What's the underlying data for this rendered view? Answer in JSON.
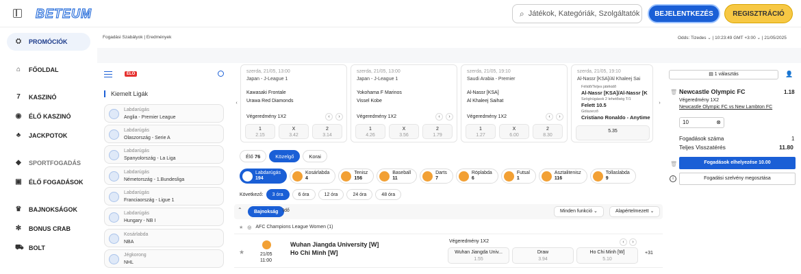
{
  "header": {
    "logo": "BETEUM",
    "search_placeholder": "Játékok, Kategóriák, Szolgáltatók",
    "login_label": "BEJELENTKEZÉS",
    "register_label": "REGISZTRÁCIÓ"
  },
  "sidebar": {
    "items": [
      {
        "label": "PROMÓCIÓK",
        "icon": "gift-icon"
      },
      {
        "label": "FŐOLDAL",
        "icon": "home-icon"
      },
      {
        "label": "KASZINÓ",
        "icon": "seven-icon"
      },
      {
        "label": "ÉLŐ KASZINÓ",
        "icon": "chip-icon"
      },
      {
        "label": "JACKPOTOK",
        "icon": "coins-icon"
      },
      {
        "label": "SPORTFOGADÁS",
        "icon": "diamond-icon"
      },
      {
        "label": "ÉLŐ FOGADÁSOK",
        "icon": "live-icon"
      },
      {
        "label": "BAJNOKSÁGOK",
        "icon": "trophy-icon"
      },
      {
        "label": "BONUS CRAB",
        "icon": "crab-icon"
      },
      {
        "label": "BOLT",
        "icon": "cart-icon"
      }
    ]
  },
  "subheader": {
    "left": "Fogadási Szabályok  |  Eredmények",
    "right": "Odds: Tizedes ⌄  |  10:23:49 GMT +3:00 ⌄  |  21/05/2025"
  },
  "left_panel": {
    "live_badge": "ÉLŐ",
    "featured_title": "Kiemelt Ligák",
    "leagues": [
      {
        "sport": "Labdarúgás",
        "name": "Anglia - Premier League"
      },
      {
        "sport": "Labdarúgás",
        "name": "Olaszország - Serie A"
      },
      {
        "sport": "Labdarúgás",
        "name": "Spanyolország - La Liga"
      },
      {
        "sport": "Labdarúgás",
        "name": "Németország - 1.Bundesliga"
      },
      {
        "sport": "Labdarúgás",
        "name": "Franciaország - Ligue 1"
      },
      {
        "sport": "Labdarúgás",
        "name": "Hungary - NB I"
      },
      {
        "sport": "Kosárlabda",
        "name": "NBA"
      },
      {
        "sport": "Jégkorong",
        "name": "NHL"
      }
    ]
  },
  "events": [
    {
      "date": "szerda, 21/05, 13:00",
      "league": "Japan - J-League 1",
      "team1": "Kawasaki Frontale",
      "team2": "Urawa Red Diamonds",
      "market": "Végeredmény 1X2",
      "odds": [
        {
          "l": "1",
          "v": "2.15"
        },
        {
          "l": "X",
          "v": "3.42"
        },
        {
          "l": "2",
          "v": "3.14"
        }
      ]
    },
    {
      "date": "szerda, 21/05, 13:00",
      "league": "Japan - J-League 1",
      "team1": "Yokohama F Marinos",
      "team2": "Vissel Kobe",
      "market": "Végeredmény 1X2",
      "odds": [
        {
          "l": "1",
          "v": "4.26"
        },
        {
          "l": "X",
          "v": "3.56"
        },
        {
          "l": "2",
          "v": "1.79"
        }
      ]
    },
    {
      "date": "szerda, 21/05, 19:10",
      "league": "Saudi Arabia - Premier",
      "team1": "Al-Nassr [KSA]",
      "team2": "Al Khaleej Saihat",
      "market": "Végeredmény 1X2",
      "odds": [
        {
          "l": "1",
          "v": "1.27"
        },
        {
          "l": "X",
          "v": "6.00"
        },
        {
          "l": "2",
          "v": "8.30"
        }
      ]
    }
  ],
  "event4": {
    "date": "szerda, 21/05, 19:10",
    "league": "Al-Nassr [KSA]/Al Khaleej Sai",
    "lines": [
      "Félidő/Teljes játékidő",
      "Al-Nassr [KSA]/Al-Nassr [K",
      "Szöglrúgások 2 lehetőség T/1",
      "Felett 10.5",
      "Gólszerző",
      "Cristiano Ronaldo - Anytime"
    ],
    "odd": "5.35"
  },
  "tabs": [
    {
      "label": "Élő",
      "count": "76"
    },
    {
      "label": "Közelgő",
      "count": ""
    },
    {
      "label": "Korai",
      "count": ""
    }
  ],
  "sports": [
    {
      "label": "Labdarúgás",
      "count": "194"
    },
    {
      "label": "Kosárlabda",
      "count": "4"
    },
    {
      "label": "Tenisz",
      "count": "156"
    },
    {
      "label": "Baseball",
      "count": "11"
    },
    {
      "label": "Darts",
      "count": "7"
    },
    {
      "label": "Röplabda",
      "count": "6"
    },
    {
      "label": "Futsal",
      "count": "1"
    },
    {
      "label": "Asztalitenisz",
      "count": "116"
    },
    {
      "label": "Tollaslabda",
      "count": "9"
    }
  ],
  "next": {
    "label": "Következő:",
    "options": [
      "3 óra",
      "6 óra",
      "12 óra",
      "24 óra",
      "48 óra"
    ]
  },
  "filters": {
    "group1": "Bajnokság",
    "group2": "Idő",
    "sel1": "Minden funkció ⌄",
    "sel2": "Alapértelmezett ⌄"
  },
  "competition": "AFC Champions League Women (1)",
  "match": {
    "team1": "Wuhan Jiangda University [W]",
    "team2": "Ho Chi Minh [W]",
    "date": "21/05",
    "time": "11:00",
    "market": "Végeredmény 1X2",
    "odds": [
      {
        "l": "Wuhan Jiangda Univ...",
        "v": "1.55"
      },
      {
        "l": "Draw",
        "v": "3.94"
      },
      {
        "l": "Ho Chi Minh [W]",
        "v": "5.10"
      }
    ],
    "more": "+31"
  },
  "slip": {
    "selected": "1 választás",
    "team": "Newcastle Olympic FC",
    "odd": "1.18",
    "market": "Végeredmény 1X2",
    "match_link": "Newcastle Olympic FC vs New Lambton FC",
    "stake": "10",
    "bets_label": "Fogadások száma",
    "bets_value": "1",
    "return_label": "Teljes Visszatérés",
    "return_value": "11.80",
    "place_label": "Fogadások elhelyezése 10.00",
    "share_label": "Fogadási szelvény megosztása"
  }
}
